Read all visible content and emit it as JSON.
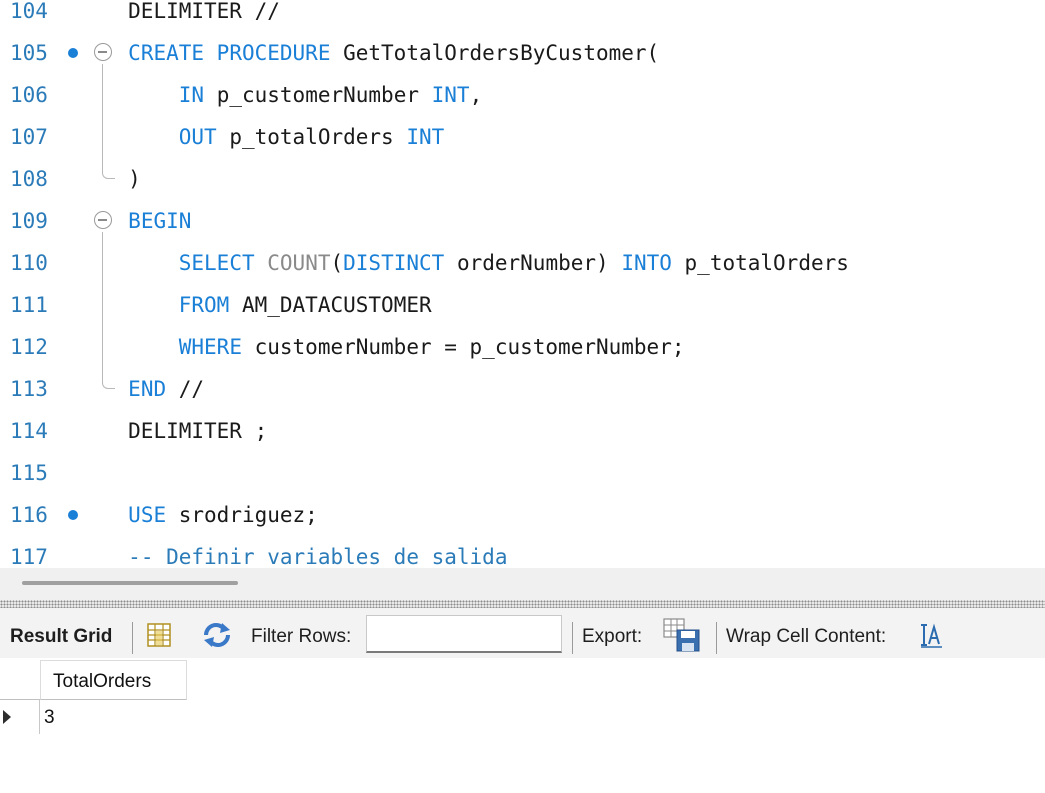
{
  "editor": {
    "lines": [
      {
        "num": "104",
        "code": [
          {
            "t": "    DELIMITER //",
            "c": "plain"
          }
        ]
      },
      {
        "num": "105",
        "code": [
          {
            "t": "    ",
            "c": "plain"
          },
          {
            "t": "CREATE PROCEDURE",
            "c": "kw"
          },
          {
            "t": " GetTotalOrdersByCustomer(",
            "c": "plain"
          }
        ]
      },
      {
        "num": "106",
        "code": [
          {
            "t": "        ",
            "c": "plain"
          },
          {
            "t": "IN",
            "c": "kw"
          },
          {
            "t": " p_customerNumber ",
            "c": "plain"
          },
          {
            "t": "INT",
            "c": "kw"
          },
          {
            "t": ",",
            "c": "plain"
          }
        ]
      },
      {
        "num": "107",
        "code": [
          {
            "t": "        ",
            "c": "plain"
          },
          {
            "t": "OUT",
            "c": "kw"
          },
          {
            "t": " p_totalOrders ",
            "c": "plain"
          },
          {
            "t": "INT",
            "c": "kw"
          }
        ]
      },
      {
        "num": "108",
        "code": [
          {
            "t": "    )",
            "c": "plain"
          }
        ]
      },
      {
        "num": "109",
        "code": [
          {
            "t": "    ",
            "c": "plain"
          },
          {
            "t": "BEGIN",
            "c": "kw"
          }
        ]
      },
      {
        "num": "110",
        "code": [
          {
            "t": "        ",
            "c": "plain"
          },
          {
            "t": "SELECT",
            "c": "kw"
          },
          {
            "t": " ",
            "c": "plain"
          },
          {
            "t": "COUNT",
            "c": "fn"
          },
          {
            "t": "(",
            "c": "plain"
          },
          {
            "t": "DISTINCT",
            "c": "kw"
          },
          {
            "t": " orderNumber) ",
            "c": "plain"
          },
          {
            "t": "INTO",
            "c": "kw"
          },
          {
            "t": " p_totalOrders",
            "c": "plain"
          }
        ]
      },
      {
        "num": "111",
        "code": [
          {
            "t": "        ",
            "c": "plain"
          },
          {
            "t": "FROM",
            "c": "kw"
          },
          {
            "t": " AM_DATACUSTOMER",
            "c": "plain"
          }
        ]
      },
      {
        "num": "112",
        "code": [
          {
            "t": "        ",
            "c": "plain"
          },
          {
            "t": "WHERE",
            "c": "kw"
          },
          {
            "t": " customerNumber = p_customerNumber;",
            "c": "plain"
          }
        ]
      },
      {
        "num": "113",
        "code": [
          {
            "t": "    ",
            "c": "plain"
          },
          {
            "t": "END",
            "c": "kw"
          },
          {
            "t": " //",
            "c": "plain"
          }
        ]
      },
      {
        "num": "114",
        "code": [
          {
            "t": "    DELIMITER ;",
            "c": "plain"
          }
        ]
      },
      {
        "num": "115",
        "code": []
      },
      {
        "num": "116",
        "code": [
          {
            "t": "    ",
            "c": "plain"
          },
          {
            "t": "USE",
            "c": "kw"
          },
          {
            "t": " srodriguez;",
            "c": "plain"
          }
        ]
      },
      {
        "num": "117",
        "code": [
          {
            "t": "    ",
            "c": "plain"
          },
          {
            "t": "-- Definir variables de salida",
            "c": "cm"
          }
        ]
      }
    ],
    "execution_dots": [
      "105",
      "116"
    ],
    "fold_markers": [
      "105",
      "109"
    ]
  },
  "result_toolbar": {
    "result_grid_label": "Result Grid",
    "filter_rows_label": "Filter Rows:",
    "filter_value": "",
    "export_label": "Export:",
    "wrap_cell_label": "Wrap Cell Content:",
    "icons": [
      "grid-layout-icon",
      "refresh-icon",
      "export-save-icon",
      "wrap-text-icon"
    ]
  },
  "result_grid": {
    "columns": [
      "TotalOrders"
    ],
    "rows": [
      [
        "3"
      ]
    ]
  },
  "colors": {
    "keyword": "#1a7fd6",
    "line_number": "#2b7bb9",
    "function": "#8a8a8a",
    "comment": "#2b7bb9"
  }
}
